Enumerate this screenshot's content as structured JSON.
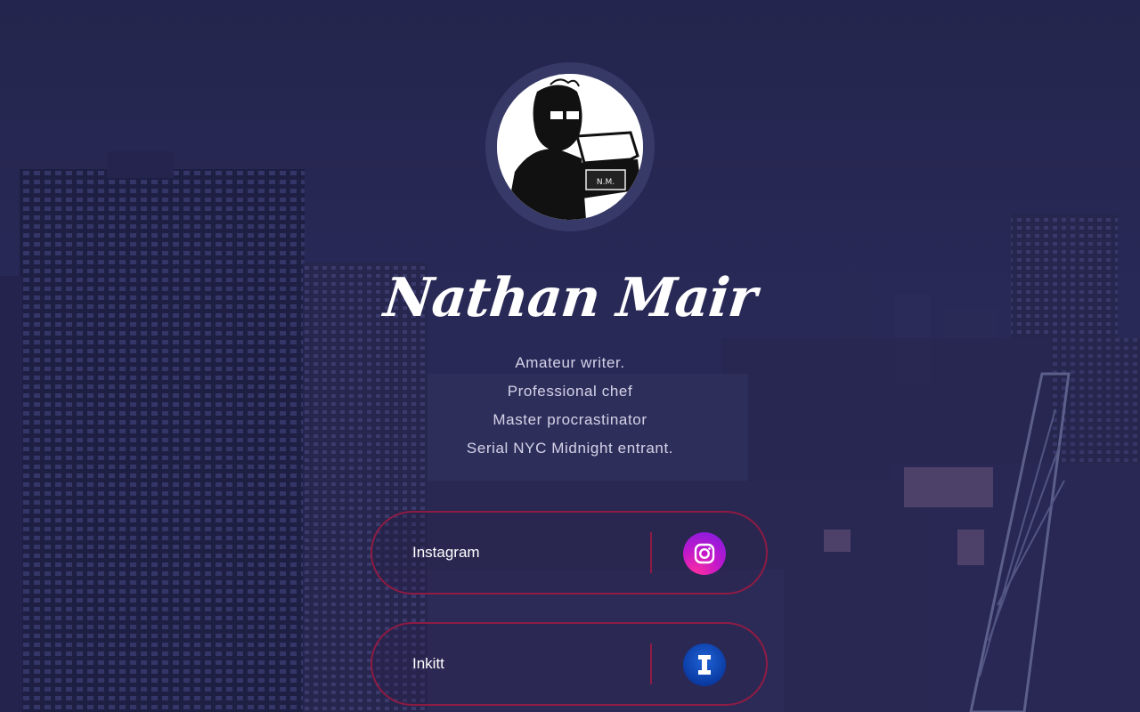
{
  "profile": {
    "name": "Nathan Mair",
    "avatar_icon": "typewriter-writer-avatar-icon",
    "avatar_monogram": "N.M."
  },
  "bio": {
    "lines": [
      "Amateur writer.",
      "Professional chef",
      "Master procrastinator",
      "Serial NYC Midnight entrant."
    ]
  },
  "links": [
    {
      "label": "Instagram",
      "icon": "instagram-icon",
      "color": "#c418c9"
    },
    {
      "label": "Inkitt",
      "icon": "inkitt-icon",
      "color": "#0a3ba3"
    }
  ],
  "theme": {
    "background": "#2a2b57",
    "accent_border": "#a01a42",
    "text": "#ffffff"
  }
}
